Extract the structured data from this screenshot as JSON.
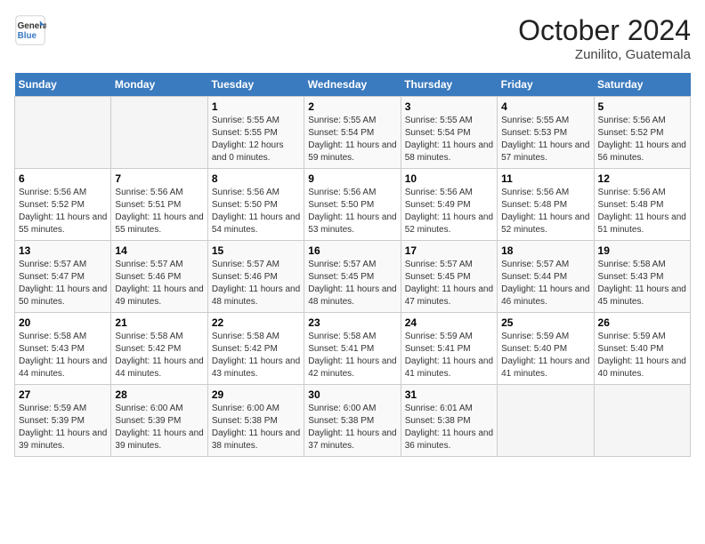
{
  "header": {
    "logo": {
      "line1": "General",
      "line2": "Blue"
    },
    "title": "October 2024",
    "subtitle": "Zunilito, Guatemala"
  },
  "weekdays": [
    "Sunday",
    "Monday",
    "Tuesday",
    "Wednesday",
    "Thursday",
    "Friday",
    "Saturday"
  ],
  "weeks": [
    [
      {
        "day": "",
        "info": ""
      },
      {
        "day": "",
        "info": ""
      },
      {
        "day": "1",
        "info": "Sunrise: 5:55 AM\nSunset: 5:55 PM\nDaylight: 12 hours and 0 minutes."
      },
      {
        "day": "2",
        "info": "Sunrise: 5:55 AM\nSunset: 5:54 PM\nDaylight: 11 hours and 59 minutes."
      },
      {
        "day": "3",
        "info": "Sunrise: 5:55 AM\nSunset: 5:54 PM\nDaylight: 11 hours and 58 minutes."
      },
      {
        "day": "4",
        "info": "Sunrise: 5:55 AM\nSunset: 5:53 PM\nDaylight: 11 hours and 57 minutes."
      },
      {
        "day": "5",
        "info": "Sunrise: 5:56 AM\nSunset: 5:52 PM\nDaylight: 11 hours and 56 minutes."
      }
    ],
    [
      {
        "day": "6",
        "info": "Sunrise: 5:56 AM\nSunset: 5:52 PM\nDaylight: 11 hours and 55 minutes."
      },
      {
        "day": "7",
        "info": "Sunrise: 5:56 AM\nSunset: 5:51 PM\nDaylight: 11 hours and 55 minutes."
      },
      {
        "day": "8",
        "info": "Sunrise: 5:56 AM\nSunset: 5:50 PM\nDaylight: 11 hours and 54 minutes."
      },
      {
        "day": "9",
        "info": "Sunrise: 5:56 AM\nSunset: 5:50 PM\nDaylight: 11 hours and 53 minutes."
      },
      {
        "day": "10",
        "info": "Sunrise: 5:56 AM\nSunset: 5:49 PM\nDaylight: 11 hours and 52 minutes."
      },
      {
        "day": "11",
        "info": "Sunrise: 5:56 AM\nSunset: 5:48 PM\nDaylight: 11 hours and 52 minutes."
      },
      {
        "day": "12",
        "info": "Sunrise: 5:56 AM\nSunset: 5:48 PM\nDaylight: 11 hours and 51 minutes."
      }
    ],
    [
      {
        "day": "13",
        "info": "Sunrise: 5:57 AM\nSunset: 5:47 PM\nDaylight: 11 hours and 50 minutes."
      },
      {
        "day": "14",
        "info": "Sunrise: 5:57 AM\nSunset: 5:46 PM\nDaylight: 11 hours and 49 minutes."
      },
      {
        "day": "15",
        "info": "Sunrise: 5:57 AM\nSunset: 5:46 PM\nDaylight: 11 hours and 48 minutes."
      },
      {
        "day": "16",
        "info": "Sunrise: 5:57 AM\nSunset: 5:45 PM\nDaylight: 11 hours and 48 minutes."
      },
      {
        "day": "17",
        "info": "Sunrise: 5:57 AM\nSunset: 5:45 PM\nDaylight: 11 hours and 47 minutes."
      },
      {
        "day": "18",
        "info": "Sunrise: 5:57 AM\nSunset: 5:44 PM\nDaylight: 11 hours and 46 minutes."
      },
      {
        "day": "19",
        "info": "Sunrise: 5:58 AM\nSunset: 5:43 PM\nDaylight: 11 hours and 45 minutes."
      }
    ],
    [
      {
        "day": "20",
        "info": "Sunrise: 5:58 AM\nSunset: 5:43 PM\nDaylight: 11 hours and 44 minutes."
      },
      {
        "day": "21",
        "info": "Sunrise: 5:58 AM\nSunset: 5:42 PM\nDaylight: 11 hours and 44 minutes."
      },
      {
        "day": "22",
        "info": "Sunrise: 5:58 AM\nSunset: 5:42 PM\nDaylight: 11 hours and 43 minutes."
      },
      {
        "day": "23",
        "info": "Sunrise: 5:58 AM\nSunset: 5:41 PM\nDaylight: 11 hours and 42 minutes."
      },
      {
        "day": "24",
        "info": "Sunrise: 5:59 AM\nSunset: 5:41 PM\nDaylight: 11 hours and 41 minutes."
      },
      {
        "day": "25",
        "info": "Sunrise: 5:59 AM\nSunset: 5:40 PM\nDaylight: 11 hours and 41 minutes."
      },
      {
        "day": "26",
        "info": "Sunrise: 5:59 AM\nSunset: 5:40 PM\nDaylight: 11 hours and 40 minutes."
      }
    ],
    [
      {
        "day": "27",
        "info": "Sunrise: 5:59 AM\nSunset: 5:39 PM\nDaylight: 11 hours and 39 minutes."
      },
      {
        "day": "28",
        "info": "Sunrise: 6:00 AM\nSunset: 5:39 PM\nDaylight: 11 hours and 39 minutes."
      },
      {
        "day": "29",
        "info": "Sunrise: 6:00 AM\nSunset: 5:38 PM\nDaylight: 11 hours and 38 minutes."
      },
      {
        "day": "30",
        "info": "Sunrise: 6:00 AM\nSunset: 5:38 PM\nDaylight: 11 hours and 37 minutes."
      },
      {
        "day": "31",
        "info": "Sunrise: 6:01 AM\nSunset: 5:38 PM\nDaylight: 11 hours and 36 minutes."
      },
      {
        "day": "",
        "info": ""
      },
      {
        "day": "",
        "info": ""
      }
    ]
  ]
}
